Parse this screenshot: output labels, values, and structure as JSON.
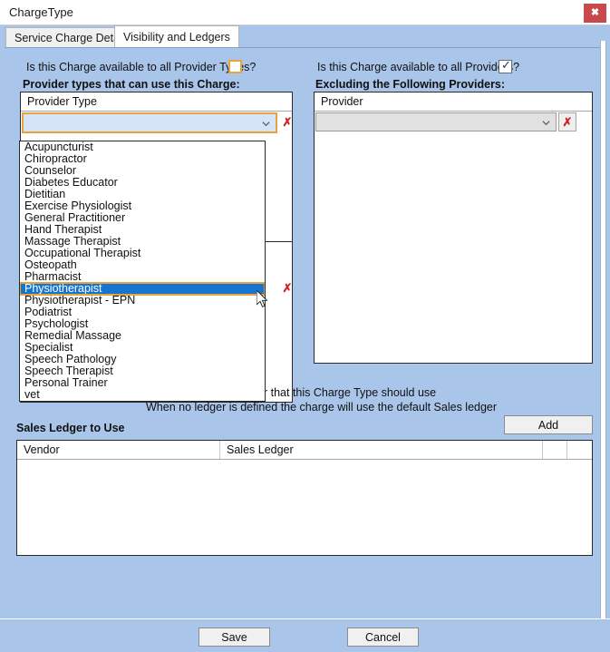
{
  "window": {
    "title": "ChargeType",
    "close_label": "✖"
  },
  "tabs": [
    {
      "label": "Service Charge Details",
      "active": false
    },
    {
      "label": "Visibility and Ledgers",
      "active": true
    }
  ],
  "left_section": {
    "question_label": "Is this Charge available to all Provider Types?",
    "checkbox_checked": false,
    "group_label": "Provider types that can use this Charge:",
    "grid_header": "Provider Type",
    "combo_value": "",
    "delete_label": "✗"
  },
  "right_section": {
    "question_label": "Is this Charge available to all Providers?",
    "checkbox_checked": true,
    "checkbox_tick": "✓",
    "group_label": "Excluding the Following Providers:",
    "grid_header": "Provider",
    "combo_value": "",
    "delete_label": "✗"
  },
  "dropdown": {
    "open": true,
    "selected": "Physiotherapist",
    "options": [
      "Acupuncturist",
      "Chiropractor",
      "Counselor",
      "Diabetes Educator",
      "Dietitian",
      "Exercise Physiologist",
      "General Practitioner",
      "Hand Therapist",
      "Massage Therapist",
      "Occupational Therapist",
      "Osteopath",
      "Pharmacist",
      "Physiotherapist",
      "Physiotherapist - EPN",
      "Podiatrist",
      "Psychologist",
      "Remedial Massage",
      "Specialist",
      "Speech Pathology",
      "Speech Therapist",
      "Personal Trainer",
      "vet"
    ]
  },
  "ledger_section": {
    "hint_line1": "Define the Sales Ledger that this Charge Type should use",
    "hint_line2": "When no ledger is defined the charge will use the default Sales ledger",
    "title": "Sales Ledger to Use",
    "add_label": "Add",
    "columns": [
      "Vendor",
      "Sales Ledger"
    ],
    "rows": []
  },
  "footer": {
    "save_label": "Save",
    "cancel_label": "Cancel"
  },
  "colors": {
    "background": "#a9c6ea",
    "focus_orange": "#e8a33d",
    "selection_blue": "#1675d1",
    "delete_red": "#d02020",
    "close_red": "#c8484c"
  }
}
